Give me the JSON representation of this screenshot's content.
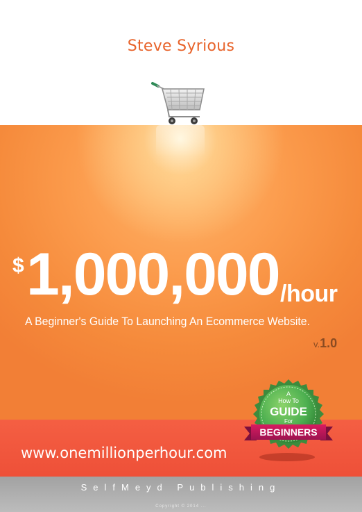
{
  "cover": {
    "author": "Steve Syrious",
    "price_symbol": "$",
    "price_amount": "1,000,000",
    "price_unit": "/hour",
    "subtitle": "A Beginner's Guide To Launching An Ecommerce Website.",
    "version_prefix": "v.",
    "version_number": "1.0",
    "website": "www.onemillionperhour.com",
    "publisher": "SelfMeyd Publishing",
    "copyright": "Copyright © 2014 ..."
  },
  "badge": {
    "line1": "A",
    "line2": "How To",
    "line3": "GUIDE",
    "line4": "For",
    "ribbon": "BEGINNERS"
  },
  "colors": {
    "author_orange": "#e8632a",
    "panel_orange": "#f58a3b",
    "band_red": "#ee5038",
    "footer_grey": "#a2a2a2",
    "badge_green": "#4caf50",
    "ribbon_magenta": "#c2185b"
  },
  "icons": {
    "cart": "shopping-cart-icon",
    "badge": "guide-badge-icon"
  }
}
